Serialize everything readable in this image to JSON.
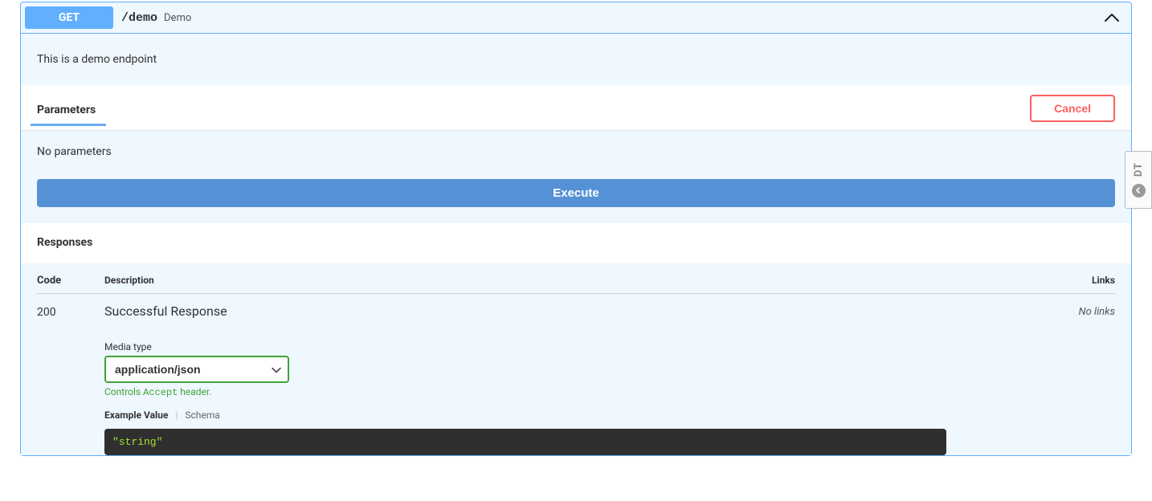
{
  "operation": {
    "method": "GET",
    "path": "/demo",
    "summary": "Demo",
    "description": "This is a demo endpoint"
  },
  "parameters": {
    "section_title": "Parameters",
    "cancel_label": "Cancel",
    "empty_text": "No parameters"
  },
  "execute": {
    "button_label": "Execute"
  },
  "responses": {
    "section_title": "Responses",
    "headers": {
      "code": "Code",
      "description": "Description",
      "links": "Links"
    },
    "rows": [
      {
        "code": "200",
        "description": "Successful Response",
        "media_type_label": "Media type",
        "media_type": "application/json",
        "accept_note_prefix": "Controls ",
        "accept_note_code": "Accept",
        "accept_note_suffix": " header.",
        "tab_example_label": "Example Value",
        "tab_schema_label": "Schema",
        "example_value": "\"string\"",
        "links_text": "No links"
      }
    ]
  },
  "badge": {
    "text": "DT"
  }
}
